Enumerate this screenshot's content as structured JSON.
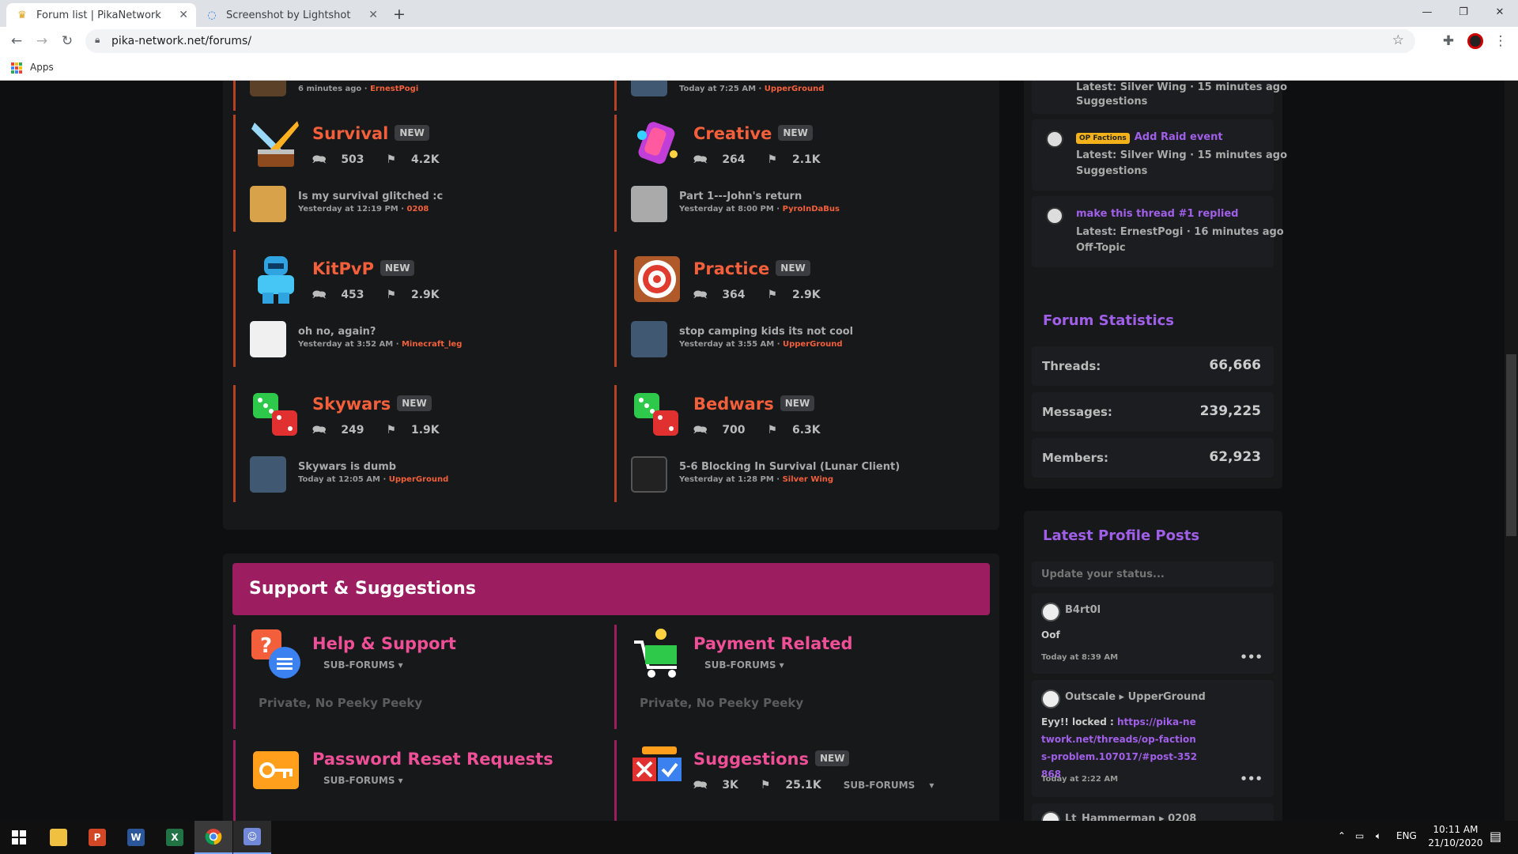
{
  "browser": {
    "tabs": [
      {
        "title": "Forum list | PikaNetwork",
        "active": true
      },
      {
        "title": "Screenshot by Lightshot",
        "active": false
      }
    ],
    "url": "pika-network.net/forums/",
    "bookmarks": {
      "apps_label": "Apps"
    }
  },
  "forums_top": {
    "partial_left": {
      "meta_time": "6 minutes ago",
      "meta_user": "ErnestPogi"
    },
    "partial_right": {
      "meta_time": "Today at 7:25 AM",
      "meta_user": "UpperGround"
    }
  },
  "forum_nodes": [
    {
      "title": "Survival",
      "badge": "NEW",
      "threads": "503",
      "messages": "4.2K",
      "latest_title": "Is my survival glitched :c",
      "latest_time": "Yesterday at 12:19 PM",
      "latest_user": "0208"
    },
    {
      "title": "Creative",
      "badge": "NEW",
      "threads": "264",
      "messages": "2.1K",
      "latest_title": "Part 1---John's return",
      "latest_time": "Yesterday at 8:00 PM",
      "latest_user": "PyroInDaBus"
    },
    {
      "title": "KitPvP",
      "badge": "NEW",
      "threads": "453",
      "messages": "2.9K",
      "latest_title": "oh no, again?",
      "latest_time": "Yesterday at 3:52 AM",
      "latest_user": "Minecraft_leg"
    },
    {
      "title": "Practice",
      "badge": "NEW",
      "threads": "364",
      "messages": "2.9K",
      "latest_title": "stop camping kids its not cool",
      "latest_time": "Yesterday at 3:55 AM",
      "latest_user": "UpperGround"
    },
    {
      "title": "Skywars",
      "badge": "NEW",
      "threads": "249",
      "messages": "1.9K",
      "latest_title": "Skywars is dumb",
      "latest_time": "Today at 12:05 AM",
      "latest_user": "UpperGround"
    },
    {
      "title": "Bedwars",
      "badge": "NEW",
      "threads": "700",
      "messages": "6.3K",
      "latest_title": "5-6 Blocking In Survival (Lunar Client)",
      "latest_time": "Yesterday at 1:28 PM",
      "latest_user": "Silver Wing"
    }
  ],
  "support": {
    "header": "Support & Suggestions",
    "sub_forums_label": "SUB-FORUMS",
    "private_text": "Private, No Peeky Peeky",
    "nodes": [
      {
        "title": "Help & Support"
      },
      {
        "title": "Payment Related"
      },
      {
        "title": "Password Reset Requests"
      },
      {
        "title": "Suggestions",
        "badge": "NEW",
        "threads": "3K",
        "messages": "25.1K"
      }
    ]
  },
  "sidebar": {
    "threads_top_partial": {
      "latest": "Latest: Silver Wing · 15 minutes ago",
      "forum": "Suggestions"
    },
    "threads": [
      {
        "prefix": "OP Factions",
        "title": "Add Raid event",
        "latest": "Latest: Silver Wing · 15 minutes ago",
        "forum": "Suggestions"
      },
      {
        "title": "make this thread #1 replied",
        "latest": "Latest: ErnestPogi · 16 minutes ago",
        "forum": "Off-Topic"
      }
    ],
    "forum_statistics": {
      "title": "Forum Statistics",
      "rows": [
        {
          "label": "Threads:",
          "value": "66,666"
        },
        {
          "label": "Messages:",
          "value": "239,225"
        },
        {
          "label": "Members:",
          "value": "62,923"
        }
      ]
    },
    "profile_posts": {
      "title": "Latest Profile Posts",
      "placeholder": "Update your status...",
      "posts": [
        {
          "user": "B4rt0l",
          "text": "Oof",
          "time": "Today at 8:39 AM"
        },
        {
          "user": "Outscale",
          "target": "UpperGround",
          "text_prefix": "Eyy!! locked : ",
          "link": "https://pika-network.net/threads/op-factions-problem.107017/#post-352868",
          "time": "Today at 2:22 AM"
        },
        {
          "user": "Lt_Hammerman",
          "target": "0208"
        }
      ]
    }
  },
  "taskbar": {
    "lang": "ENG",
    "time": "10:11 AM",
    "date": "21/10/2020"
  }
}
